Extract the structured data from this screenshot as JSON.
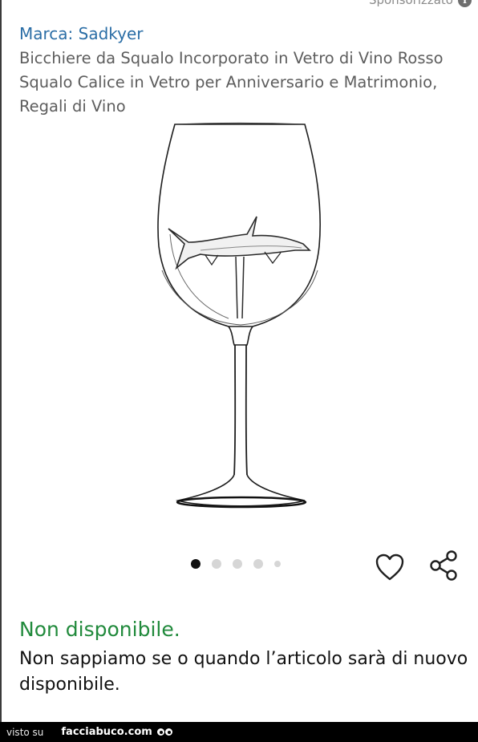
{
  "header": {
    "sponsored_label": "Sponsorizzato",
    "info_icon": "info-icon"
  },
  "product": {
    "brand": "Marca: Sadkyer",
    "title": "Bicchiere da Squalo Incorporato in Vetro di Vino Rosso Squalo Calice in Vetro per Anniversario e Matrimonio, Regali di Vino",
    "image_description_icon": "wine-glass-with-shark"
  },
  "carousel": {
    "dot_count": 5,
    "active_index": 0
  },
  "actions": {
    "wishlist_icon": "heart-icon",
    "share_icon": "share-icon"
  },
  "availability": {
    "status": "Non disponibile.",
    "message": "Non sappiamo se o quando l’articolo sarà di nuovo disponibile."
  },
  "footer": {
    "seen_on": "visto su",
    "site": "facciabuco.com"
  },
  "colors": {
    "brand_link": "#2b6ea6",
    "status_green": "#218a3c"
  }
}
